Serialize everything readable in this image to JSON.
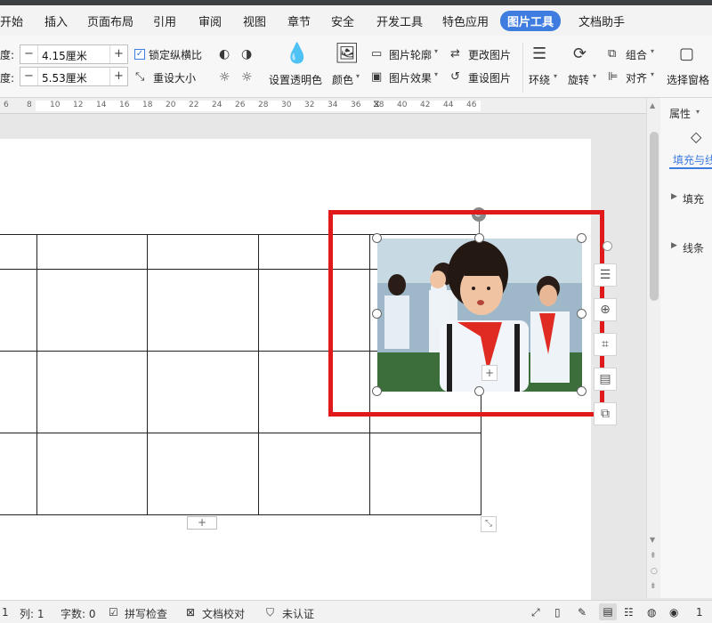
{
  "menu": {
    "items": [
      "开始",
      "插入",
      "页面布局",
      "引用",
      "审阅",
      "视图",
      "章节",
      "安全",
      "开发工具",
      "特色应用",
      "图片工具",
      "文档助手"
    ],
    "active": "图片工具"
  },
  "ribbon": {
    "height_label": "度:",
    "width_label": "度:",
    "height_value": "4.15厘米",
    "width_value": "5.53厘米",
    "lock_ratio": "锁定纵横比",
    "reset_size": "重设大小",
    "transparency": "设置透明色",
    "color": "颜色",
    "outline": "图片轮廓",
    "effects": "图片效果",
    "change_picture": "更改图片",
    "reset_picture": "重设图片",
    "wrap": "环绕",
    "rotate": "旋转",
    "group": "组合",
    "align": "对齐",
    "selection_pane": "选择窗格"
  },
  "ruler": {
    "ticks": [
      "6",
      "8",
      "10",
      "12",
      "14",
      "16",
      "18",
      "20",
      "22",
      "24",
      "26",
      "28",
      "30",
      "32",
      "34",
      "36",
      "38",
      "40",
      "42",
      "44",
      "46"
    ]
  },
  "side_panel": {
    "title": "属性",
    "tab": "填充与线",
    "fill": "填充",
    "line": "线条"
  },
  "status": {
    "page": "1",
    "column": "列: 1",
    "word_count": "字数: 0",
    "spell_check": "拼写检查",
    "doc_proof": "文档校对",
    "auth": "未认证",
    "zoom": "1"
  },
  "colors": {
    "accent": "#3f7ce0",
    "highlight_box": "#e01a1a"
  }
}
